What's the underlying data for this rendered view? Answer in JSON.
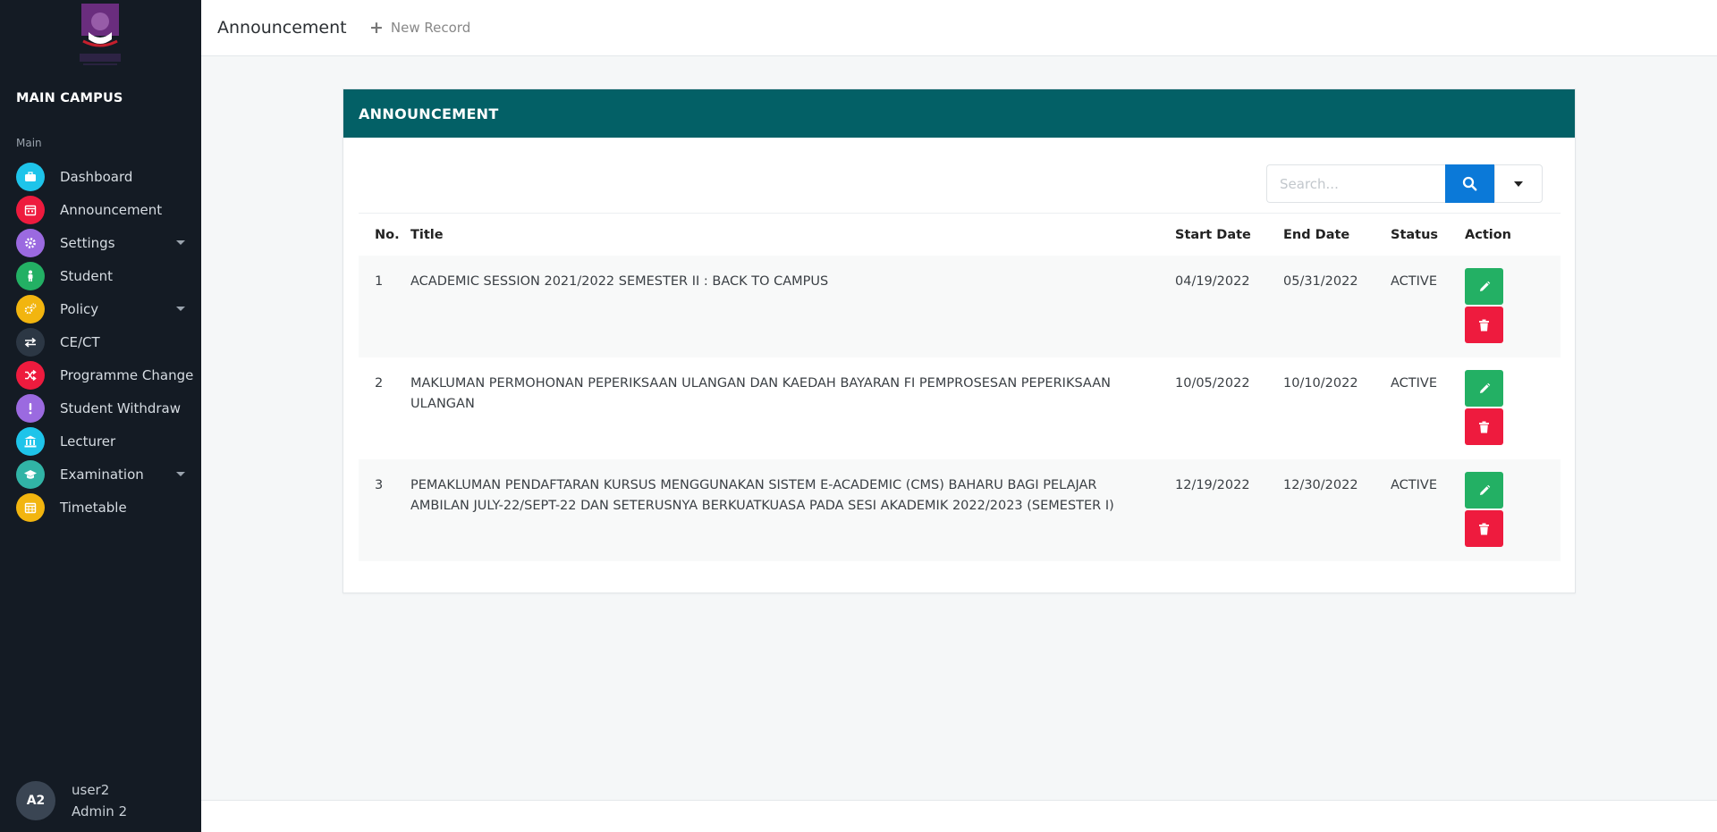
{
  "sidebar": {
    "campus": "MAIN CAMPUS",
    "section": "Main",
    "items": [
      {
        "label": "Dashboard",
        "color": "#1ec4ea",
        "icon": "briefcase-icon"
      },
      {
        "label": "Announcement",
        "color": "#ee1b3e",
        "icon": "calendar-icon"
      },
      {
        "label": "Settings",
        "color": "#9b6ae0",
        "icon": "gear-icon"
      },
      {
        "label": "Student",
        "color": "#23b064",
        "icon": "person-icon"
      },
      {
        "label": "Policy",
        "color": "#f2b50f",
        "icon": "gears-icon"
      },
      {
        "label": "CE/CT",
        "color": "#2c3744",
        "icon": "exchange-icon"
      },
      {
        "label": "Programme Change",
        "color": "#ee1b3e",
        "icon": "shuffle-icon"
      },
      {
        "label": "Student Withdraw",
        "color": "#9b6ae0",
        "icon": "exclamation-icon"
      },
      {
        "label": "Lecturer",
        "color": "#1ec4ea",
        "icon": "institution-icon"
      },
      {
        "label": "Examination",
        "color": "#31b4a6",
        "icon": "graduation-cap-icon"
      },
      {
        "label": "Timetable",
        "color": "#f2b50f",
        "icon": "calendar-grid-icon"
      }
    ],
    "user": {
      "initials": "A2",
      "name": "user2",
      "role": "Admin 2"
    }
  },
  "topbar": {
    "title": "Announcement",
    "new_record": "New Record"
  },
  "card": {
    "title": "ANNOUNCEMENT",
    "search_placeholder": "Search...",
    "columns": [
      "No.",
      "Title",
      "Start Date",
      "End Date",
      "Status",
      "Action"
    ],
    "rows": [
      {
        "no": "1",
        "title": "ACADEMIC SESSION 2021/2022 SEMESTER II : BACK TO CAMPUS",
        "start": "04/19/2022",
        "end": "05/31/2022",
        "status": "ACTIVE"
      },
      {
        "no": "2",
        "title": "MAKLUMAN PERMOHONAN PEPERIKSAAN ULANGAN DAN KAEDAH BAYARAN FI PEMPROSESAN PEPERIKSAAN ULANGAN",
        "start": "10/05/2022",
        "end": "10/10/2022",
        "status": "ACTIVE"
      },
      {
        "no": "3",
        "title": "PEMAKLUMAN PENDAFTARAN KURSUS MENGGUNAKAN SISTEM E-ACADEMIC (CMS) BAHARU BAGI PELAJAR AMBILAN JULY-22/SEPT-22 DAN SETERUSNYA BERKUATKUASA PADA SESI AKADEMIK 2022/2023 (SEMESTER I)",
        "start": "12/19/2022",
        "end": "12/30/2022",
        "status": "ACTIVE"
      }
    ]
  },
  "colors": {
    "header": "#036066",
    "sidebar": "#141b24",
    "edit": "#23b064",
    "delete": "#ee1b3e",
    "search": "#0b79d8"
  }
}
